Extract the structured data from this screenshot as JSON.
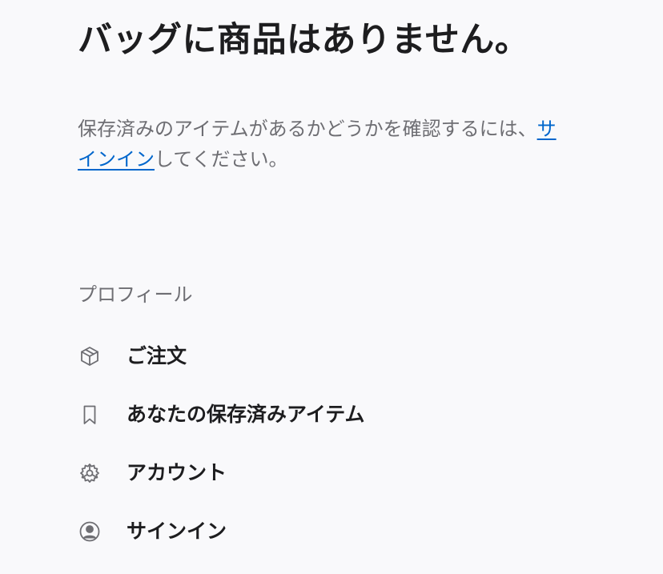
{
  "bag": {
    "title": "バッグに商品はありません。",
    "message_before": "保存済みのアイテムがあるかどうかを確認するには、",
    "sign_in_link": "サインイン",
    "message_after": "してください。"
  },
  "profile": {
    "heading": "プロフィール",
    "items": [
      {
        "label": "ご注文",
        "icon": "package-icon"
      },
      {
        "label": "あなたの保存済みアイテム",
        "icon": "bookmark-icon"
      },
      {
        "label": "アカウント",
        "icon": "gear-icon"
      },
      {
        "label": "サインイン",
        "icon": "person-circle-icon"
      }
    ]
  },
  "colors": {
    "background": "#f9f9fb",
    "text_primary": "#1d1d1f",
    "text_secondary": "#6e6e73",
    "link": "#0066cc",
    "icon": "#6e6e73"
  }
}
